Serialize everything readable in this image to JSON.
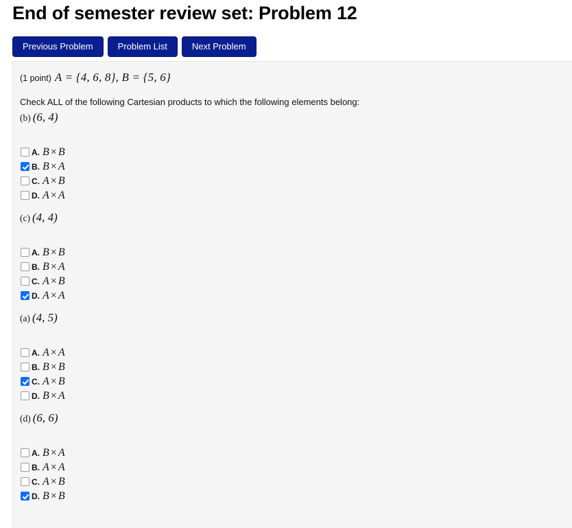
{
  "page": {
    "title": "End of semester review set: Problem 12",
    "panel_bg": "#f5f5f5",
    "accent_blue": "#0a1f8f",
    "checkbox_checked_color": "#0d6efd"
  },
  "nav": {
    "buttons": [
      {
        "label": "Previous Problem",
        "name": "previous-problem-button"
      },
      {
        "label": "Problem List",
        "name": "problem-list-button"
      },
      {
        "label": "Next Problem",
        "name": "next-problem-button"
      }
    ]
  },
  "problem": {
    "points": "(1 point)",
    "sets": "A = {4, 6, 8}, B = {5, 6}",
    "set_a_name": "A",
    "set_a_elements": "{4, 6, 8}",
    "set_b_name": "B",
    "set_b_elements": "{5, 6}",
    "instruction": "Check ALL of the following Cartesian products to which the following elements belong:",
    "groups": [
      {
        "tag": "(b)",
        "pair": "(6, 4)",
        "options": [
          {
            "letter": "A.",
            "math": "B × B",
            "left": "B",
            "right": "B",
            "checked": false
          },
          {
            "letter": "B.",
            "math": "B × A",
            "left": "B",
            "right": "A",
            "checked": true
          },
          {
            "letter": "C.",
            "math": "A × B",
            "left": "A",
            "right": "B",
            "checked": false
          },
          {
            "letter": "D.",
            "math": "A × A",
            "left": "A",
            "right": "A",
            "checked": false
          }
        ]
      },
      {
        "tag": "(c)",
        "pair": "(4, 4)",
        "options": [
          {
            "letter": "A.",
            "math": "B × B",
            "left": "B",
            "right": "B",
            "checked": false
          },
          {
            "letter": "B.",
            "math": "B × A",
            "left": "B",
            "right": "A",
            "checked": false
          },
          {
            "letter": "C.",
            "math": "A × B",
            "left": "A",
            "right": "B",
            "checked": false
          },
          {
            "letter": "D.",
            "math": "A × A",
            "left": "A",
            "right": "A",
            "checked": true
          }
        ]
      },
      {
        "tag": "(a)",
        "pair": "(4, 5)",
        "options": [
          {
            "letter": "A.",
            "math": "A × A",
            "left": "A",
            "right": "A",
            "checked": false
          },
          {
            "letter": "B.",
            "math": "B × B",
            "left": "B",
            "right": "B",
            "checked": false
          },
          {
            "letter": "C.",
            "math": "A × B",
            "left": "A",
            "right": "B",
            "checked": true
          },
          {
            "letter": "D.",
            "math": "B × A",
            "left": "B",
            "right": "A",
            "checked": false
          }
        ]
      },
      {
        "tag": "(d)",
        "pair": "(6, 6)",
        "options": [
          {
            "letter": "A.",
            "math": "B × A",
            "left": "B",
            "right": "A",
            "checked": false
          },
          {
            "letter": "B.",
            "math": "A × A",
            "left": "A",
            "right": "A",
            "checked": false
          },
          {
            "letter": "C.",
            "math": "A × B",
            "left": "A",
            "right": "B",
            "checked": false
          },
          {
            "letter": "D.",
            "math": "B × B",
            "left": "B",
            "right": "B",
            "checked": true
          }
        ]
      }
    ]
  }
}
